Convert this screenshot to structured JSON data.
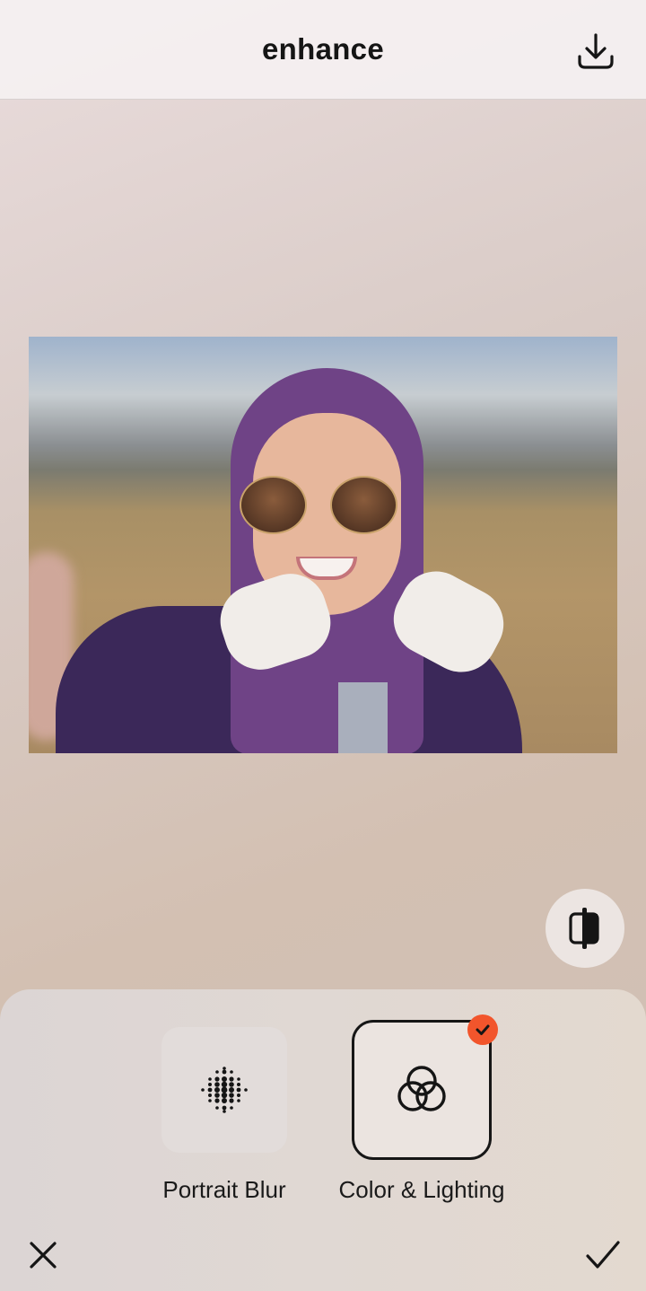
{
  "header": {
    "title": "enhance",
    "download_icon": "download-icon"
  },
  "photo": {
    "description_icon": "edited-photo"
  },
  "compare": {
    "icon": "compare-split-icon"
  },
  "tools": [
    {
      "label": "Portrait Blur",
      "icon": "portrait-blur-dots-icon",
      "selected": false
    },
    {
      "label": "Color & Lighting",
      "icon": "color-lighting-rings-icon",
      "selected": true
    }
  ],
  "footer": {
    "cancel_icon": "close-icon",
    "apply_icon": "checkmark-icon"
  },
  "colors": {
    "accent_badge": "#f2552c",
    "selected_border": "#161616"
  }
}
